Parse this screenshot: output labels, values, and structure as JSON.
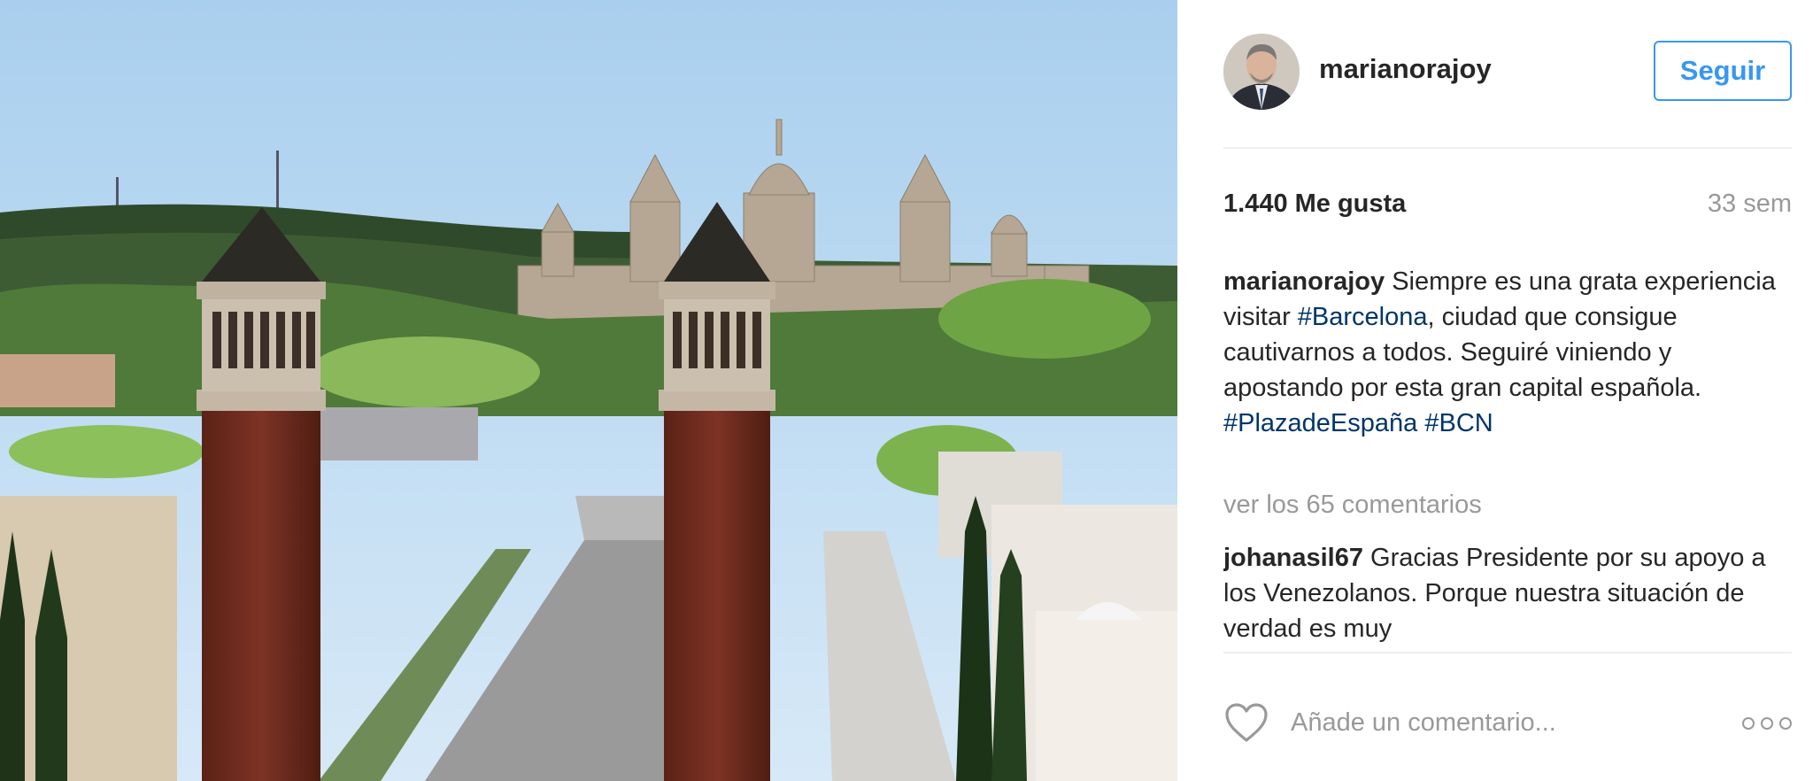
{
  "post": {
    "username": "marianorajoy",
    "follow_label": "Seguir",
    "likes": "1.440 Me gusta",
    "time": "33 sem",
    "caption": {
      "user": "marianorajoy",
      "part1": " Siempre es una grata experiencia visitar ",
      "tag1": "#Barcelona",
      "part2": ", ciudad que consigue cautivarnos a todos. Seguiré viniendo y apostando por esta gran capital española. ",
      "tag2": "#PlazadeEspaña",
      "part3": " ",
      "tag3": "#BCN"
    },
    "view_comments": "ver los 65 comentarios",
    "comment": {
      "user": "johanasil67",
      "text": " Gracias Presidente por su apoyo a los Venezolanos. Porque nuestra situación de verdad es muy"
    },
    "add_comment_placeholder": "Añade un comentario...",
    "colors": {
      "accent": "#3897f0",
      "hashtag": "#003569",
      "muted": "#999999",
      "text": "#262626"
    },
    "icons": {
      "like": "heart-outline-icon",
      "more": "more-options-icon"
    }
  }
}
